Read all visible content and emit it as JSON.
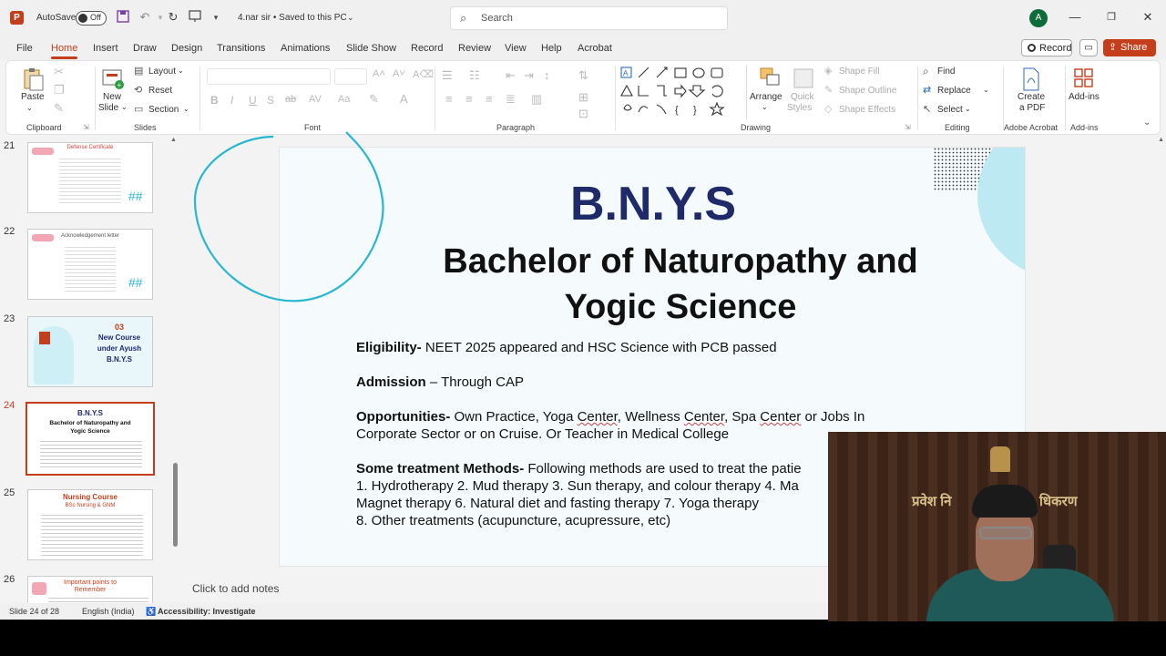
{
  "titlebar": {
    "app_icon": "P",
    "autosave_label": "AutoSave",
    "autosave_state": "Off",
    "file_title": "4.nar sir • Saved to this PC",
    "search_placeholder": "Search",
    "user_initial": "A"
  },
  "menu": {
    "items": [
      "File",
      "Home",
      "Insert",
      "Draw",
      "Design",
      "Transitions",
      "Animations",
      "Slide Show",
      "Record",
      "Review",
      "View",
      "Help",
      "Acrobat"
    ],
    "active": "Home",
    "record_label": "Record",
    "share_label": "Share"
  },
  "ribbon": {
    "clipboard": {
      "paste": "Paste",
      "label": "Clipboard"
    },
    "slides": {
      "new_slide_1": "New",
      "new_slide_2": "Slide",
      "layout": "Layout",
      "reset": "Reset",
      "section": "Section",
      "label": "Slides"
    },
    "font": {
      "label": "Font"
    },
    "paragraph": {
      "label": "Paragraph"
    },
    "drawing": {
      "arrange": "Arrange",
      "quick_styles_1": "Quick",
      "quick_styles_2": "Styles",
      "shape_fill": "Shape Fill",
      "shape_outline": "Shape Outline",
      "shape_effects": "Shape Effects",
      "label": "Drawing"
    },
    "editing": {
      "find": "Find",
      "replace": "Replace",
      "select": "Select",
      "label": "Editing"
    },
    "acrobat": {
      "create_1": "Create",
      "create_2": "a PDF",
      "label": "Adobe Acrobat"
    },
    "addins": {
      "addins": "Add-ins",
      "label": "Add-ins"
    }
  },
  "thumbnails": [
    {
      "num": "21",
      "title": "Defense Certificate"
    },
    {
      "num": "22",
      "title": "Acknowledgement letter"
    },
    {
      "num": "23",
      "title_num": "03",
      "title_1": "New Course",
      "title_2": "under Ayush",
      "title_3": "B.N.Y.S"
    },
    {
      "num": "24",
      "title_1": "B.N.Y.S",
      "title_2": "Bachelor of Naturopathy and",
      "title_3": "Yogic Science"
    },
    {
      "num": "25",
      "title_1": "Nursing Course",
      "title_2": "BSc Nursing & GNM"
    },
    {
      "num": "26",
      "title_1": "Important points to",
      "title_2": "Remember"
    }
  ],
  "slide": {
    "heading": "B.N.Y.S",
    "subtitle_1": "Bachelor of Naturopathy and",
    "subtitle_2": "Yogic Science",
    "eligibility_label": "Eligibility-",
    "eligibility_text": " NEET 2025 appeared and HSC Science with PCB passed",
    "admission_label": "Admission",
    "admission_text": " – Through CAP",
    "opportunities_label": "Opportunities-",
    "opp_1": "  Own Practice, Yoga ",
    "opp_center1": "Center",
    "opp_2": ", Wellness ",
    "opp_center2": "Center",
    "opp_3": ", Spa ",
    "opp_center3": "Center",
    "opp_4": " or Jobs In",
    "opp_line2": "Corporate Sector or on Cruise. Or Teacher in Medical College",
    "treat_label": "Some treatment Methods-",
    "treat_text": " Following methods are used to treat the patie",
    "treat_line1": "1. Hydrotherapy  2. Mud therapy  3. Sun therapy, and colour therapy 4. Ma",
    "treat_line2": "Magnet therapy 6. Natural diet and fasting therapy 7. Yoga therapy",
    "treat_line3": "8. Other treatments (acupuncture, acupressure, etc)"
  },
  "notes_placeholder": "Click to add notes",
  "status": {
    "slide_count": "Slide 24 of 28",
    "language": "English (India)",
    "accessibility": "Accessibility: Investigate"
  },
  "webcam": {
    "sign_left": "प्रवेश नि",
    "sign_right": "धिकरण"
  },
  "colors": {
    "accent": "#c43e1c",
    "slide_heading": "#1f2a6b",
    "decor_cyan": "#29b6d0"
  }
}
